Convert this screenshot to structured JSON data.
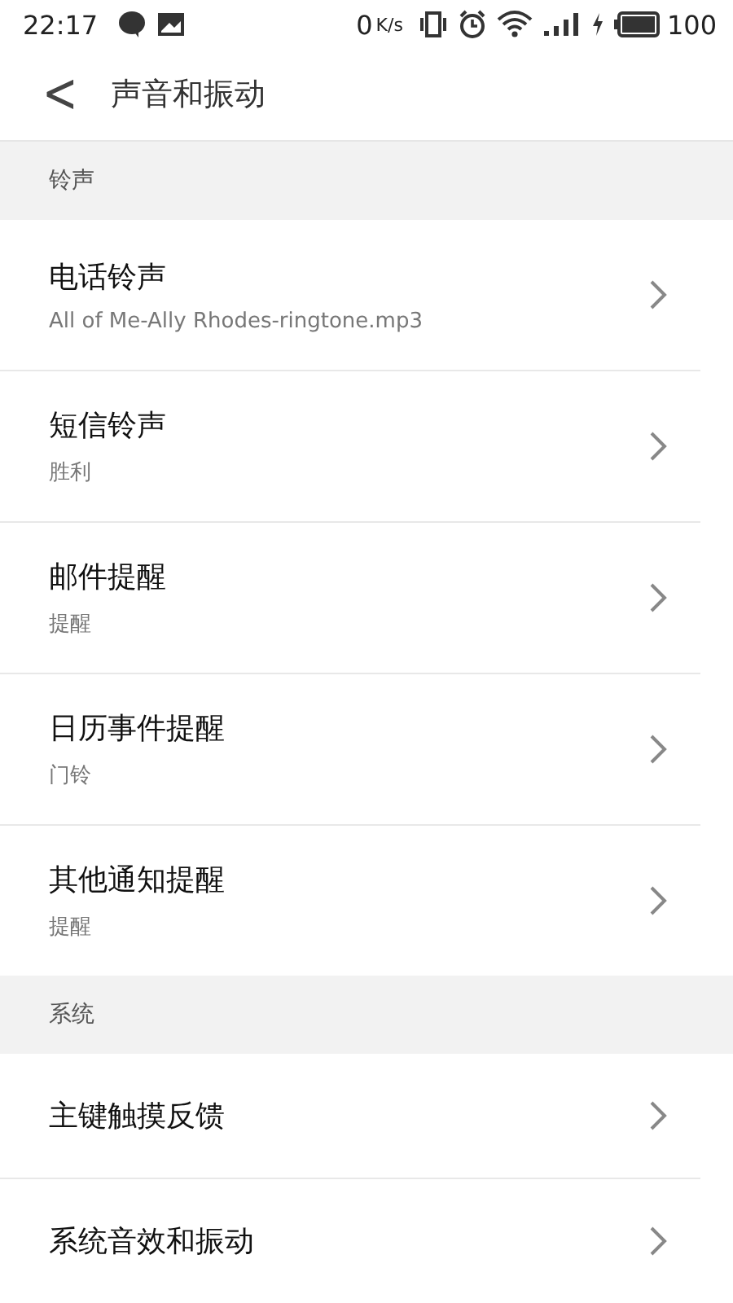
{
  "status_bar": {
    "time": "22:17",
    "speed_value": "0",
    "speed_unit": "K/s",
    "battery": "100"
  },
  "header": {
    "back": "<",
    "title": "声音和振动"
  },
  "sections": [
    {
      "title": "铃声",
      "items": [
        {
          "title": "电话铃声",
          "subtitle": "All of Me-Ally Rhodes-ringtone.mp3"
        },
        {
          "title": "短信铃声",
          "subtitle": "胜利"
        },
        {
          "title": "邮件提醒",
          "subtitle": "提醒"
        },
        {
          "title": "日历事件提醒",
          "subtitle": "门铃"
        },
        {
          "title": "其他通知提醒",
          "subtitle": "提醒"
        }
      ]
    },
    {
      "title": "系统",
      "items": [
        {
          "title": "主键触摸反馈"
        },
        {
          "title": "系统音效和振动"
        }
      ]
    }
  ]
}
